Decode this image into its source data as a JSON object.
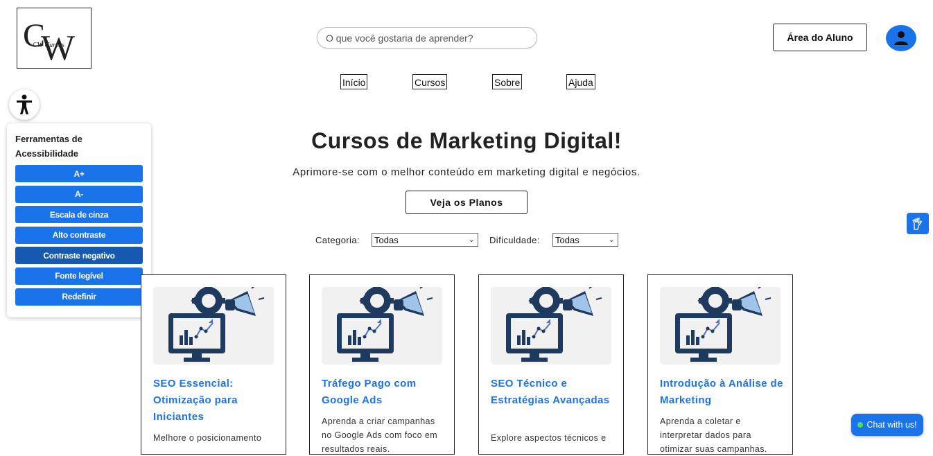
{
  "header": {
    "logo_text": "CW Cursos",
    "search_placeholder": "O que você gostaria de aprender?",
    "student_area_label": "Área do Aluno",
    "avatar_icon": "user-icon"
  },
  "nav": {
    "items": [
      {
        "label": "Início"
      },
      {
        "label": "Cursos"
      },
      {
        "label": "Sobre"
      },
      {
        "label": "Ajuda"
      }
    ]
  },
  "accessibility": {
    "toggle_icon": "accessibility-icon",
    "title": "Ferramentas de Acessibilidade",
    "buttons": [
      {
        "label": "A+"
      },
      {
        "label": "A-"
      },
      {
        "label": "Escala de cinza"
      },
      {
        "label": "Alto contraste"
      },
      {
        "label": "Contraste negativo"
      },
      {
        "label": "Fonte legível"
      },
      {
        "label": "Redefinir"
      }
    ]
  },
  "hero": {
    "title": "Cursos de Marketing Digital!",
    "subtitle": "Aprimore-se com o melhor conteúdo em marketing digital e negócios.",
    "cta_label": "Veja os Planos"
  },
  "filters": {
    "category_label": "Categoria:",
    "category_value": "Todas",
    "difficulty_label": "Dificuldade:",
    "difficulty_value": "Todas"
  },
  "courses": [
    {
      "title": "SEO Essencial: Otimização para Iniciantes",
      "desc": "Melhore o posicionamento"
    },
    {
      "title": "Tráfego Pago com Google Ads",
      "desc": "Aprenda a criar campanhas no Google Ads com foco em resultados reais."
    },
    {
      "title": "SEO Técnico e Estratégias Avançadas",
      "desc": "Explore aspectos técnicos e"
    },
    {
      "title": "Introdução à Análise de Marketing",
      "desc": "Aprenda a coletar e interpretar dados para otimizar suas campanhas."
    }
  ],
  "widgets": {
    "vlibras_icon": "sign-language-icon",
    "chat_label": "Chat with us!"
  },
  "colors": {
    "accent": "#1a73e8",
    "accent_dark": "#1758b0",
    "illustration": "#1e3a5f"
  }
}
